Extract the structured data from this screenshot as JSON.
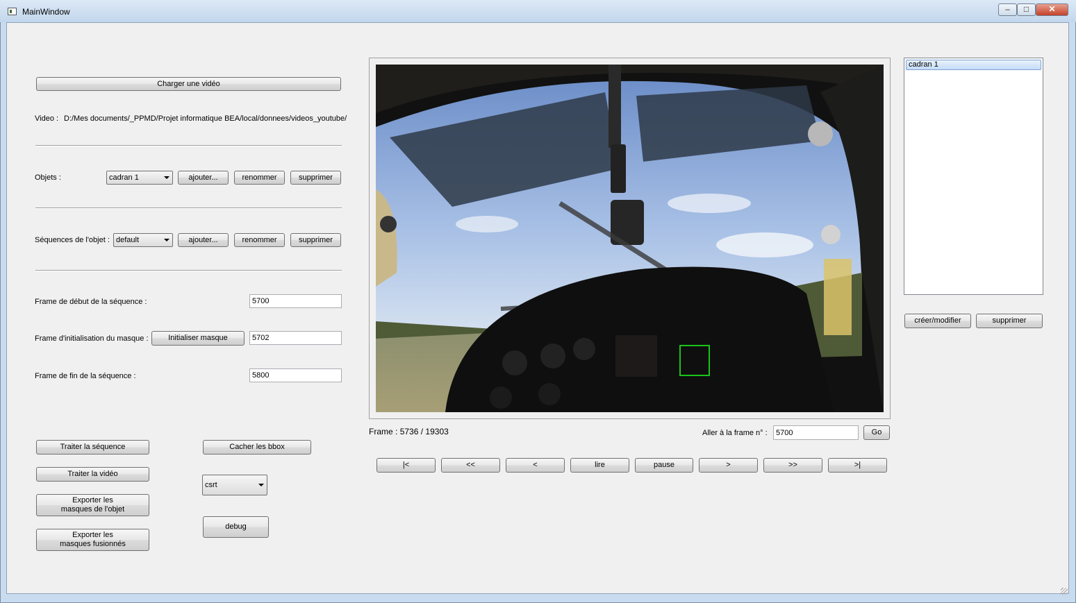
{
  "window": {
    "title": "MainWindow",
    "minimize": "‒",
    "maximize": "□",
    "close": "✕"
  },
  "left": {
    "load_video_button": "Charger une vidéo",
    "video_label": "Video :",
    "video_path": "D:/Mes documents/_PPMD/Projet informatique BEA/local/donnees/videos_youtube/",
    "objects_label": "Objets :",
    "objects_select": "cadran 1",
    "objects_add": "ajouter...",
    "objects_rename": "renommer",
    "objects_delete": "supprimer",
    "sequences_label": "Séquences de l'objet :",
    "sequences_select": "default",
    "sequences_add": "ajouter...",
    "sequences_rename": "renommer",
    "sequences_delete": "supprimer",
    "start_frame_label": "Frame de début de la séquence :",
    "start_frame_value": "5700",
    "init_frame_label": "Frame d'initialisation du masque :",
    "init_mask_button": "Initialiser masque",
    "init_frame_value": "5702",
    "end_frame_label": "Frame de fin de la séquence :",
    "end_frame_value": "5800",
    "process_sequence": "Traiter la séquence",
    "process_video": "Traiter la vidéo",
    "export_object_masks_l1": "Exporter les",
    "export_object_masks_l2": "masques de l'objet",
    "export_fused_masks_l1": "Exporter les",
    "export_fused_masks_l2": "masques fusionnés",
    "hide_bbox": "Cacher les bbox",
    "tracker_select": "csrt",
    "debug": "debug"
  },
  "player": {
    "frame_label": "Frame :",
    "frame_current": "5736",
    "frame_sep": "/",
    "frame_total": "19303",
    "goto_label": "Aller à la frame n° :",
    "goto_value": "5700",
    "go_button": "Go",
    "controls": {
      "first": "|<",
      "fast_back": "<<",
      "back": "<",
      "play": "lire",
      "pause": "pause",
      "forward": ">",
      "fast_forward": ">>",
      "last": ">|"
    }
  },
  "right": {
    "list_items": [
      "cadran 1"
    ],
    "create_modify": "créer/modifier",
    "delete": "supprimer"
  },
  "colors": {
    "bbox": "#19c419",
    "selection": "#c4dcf7"
  }
}
